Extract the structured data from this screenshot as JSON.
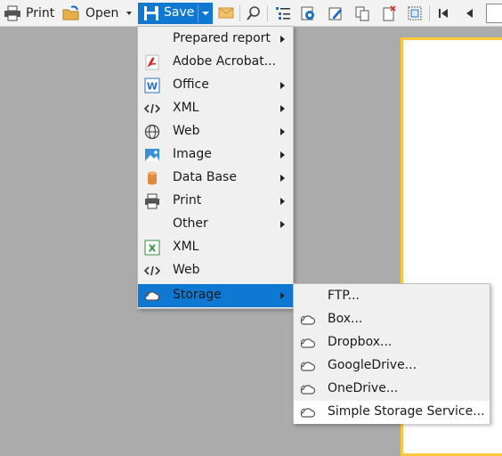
{
  "toolbar": {
    "print_label": "Print",
    "open_label": "Open",
    "save_label": "Save"
  },
  "save_menu": {
    "items": [
      {
        "label": "Prepared report",
        "icon": "none",
        "submenu": true
      },
      {
        "label": "Adobe Acrobat...",
        "icon": "pdf-icon",
        "submenu": false
      },
      {
        "label": "Office",
        "icon": "word-icon",
        "submenu": true
      },
      {
        "label": "XML",
        "icon": "code-icon",
        "submenu": true
      },
      {
        "label": "Web",
        "icon": "globe-icon",
        "submenu": true
      },
      {
        "label": "Image",
        "icon": "image-icon",
        "submenu": true
      },
      {
        "label": "Data Base",
        "icon": "database-icon",
        "submenu": true
      },
      {
        "label": "Print",
        "icon": "printer-icon",
        "submenu": true
      },
      {
        "label": "Other",
        "icon": "none",
        "submenu": true
      },
      {
        "label": "XML",
        "icon": "excel-icon",
        "submenu": false
      },
      {
        "label": "Web",
        "icon": "code-icon",
        "submenu": false
      },
      {
        "label": "Storage",
        "icon": "cloud-icon",
        "submenu": true,
        "active": true
      }
    ]
  },
  "storage_menu": {
    "items": [
      {
        "label": "FTP...",
        "icon": "none"
      },
      {
        "label": "Box...",
        "icon": "cloud-icon"
      },
      {
        "label": "Dropbox...",
        "icon": "cloud-icon"
      },
      {
        "label": "GoogleDrive...",
        "icon": "cloud-icon"
      },
      {
        "label": "OneDrive...",
        "icon": "cloud-icon"
      },
      {
        "label": "Simple Storage Service...",
        "icon": "cloud-icon",
        "hover": true
      }
    ]
  },
  "colors": {
    "accent": "#0f78d3",
    "page_border": "#ffc83d",
    "workspace": "#ababab"
  }
}
